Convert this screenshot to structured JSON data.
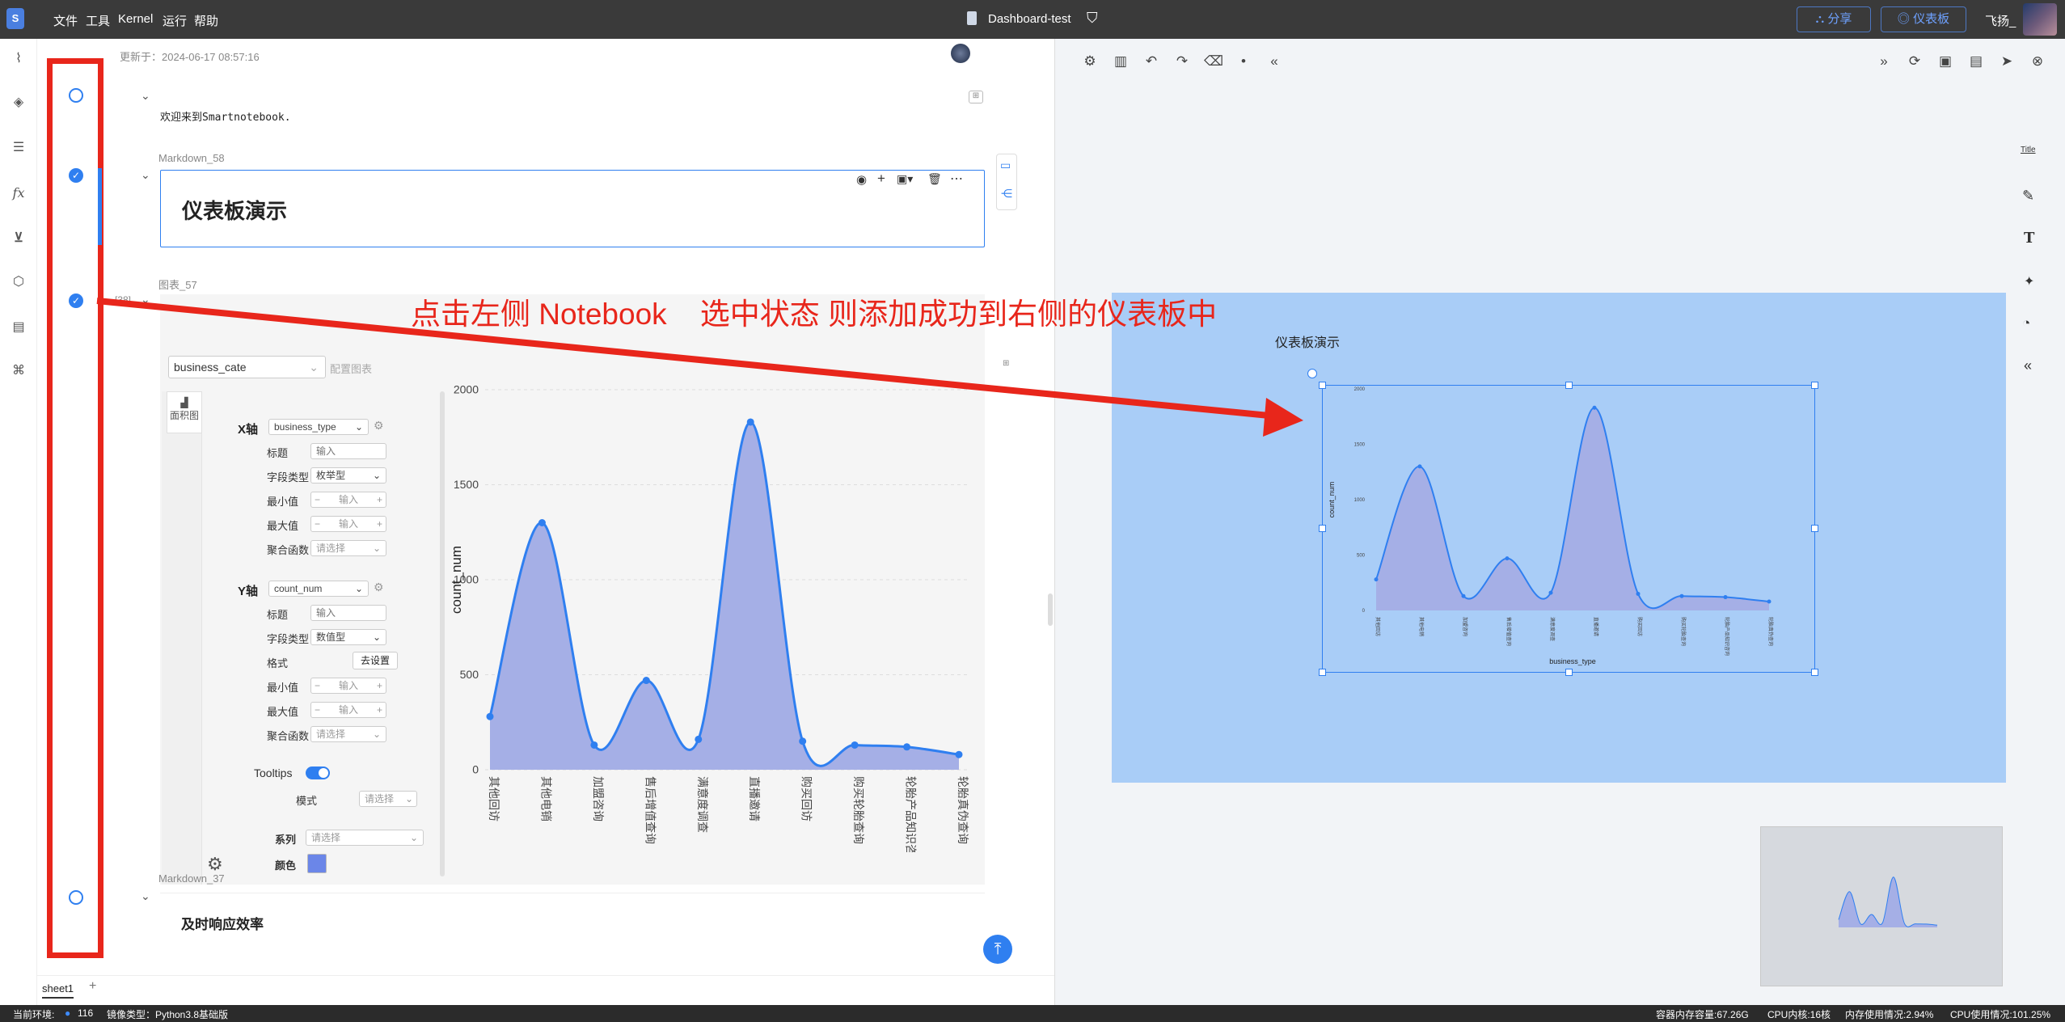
{
  "topbar": {
    "logo": "S",
    "menu": [
      "文件",
      "工具",
      "Kernel",
      "运行",
      "帮助"
    ],
    "title": "Dashboard-test",
    "share_label": "分享",
    "dashboard_label": "仪表板",
    "user": "飞扬_"
  },
  "notebook": {
    "updated": "更新于：2024-06-17 08:57:16",
    "welcome_text": "欢迎来到Smartnotebook.",
    "cell1_label": "Markdown_58",
    "cell1_heading": "仪表板演示",
    "cell2_label": "图表_57",
    "cell2_exec": "[38]",
    "cell3_label": "Markdown_37",
    "cell3_heading": "及时响应效率",
    "sheet_tab": "sheet1",
    "sheet_add": "+"
  },
  "chart_config": {
    "dataset_select": "business_cate",
    "dataset_extra": "配置图表",
    "chart_type_label": "面积图",
    "x_axis": {
      "label": "X轴",
      "field": "business_type",
      "title_label": "标题",
      "title_placeholder": "输入",
      "type_label": "字段类型",
      "type_value": "枚举型",
      "min_label": "最小值",
      "max_label": "最大值",
      "stepper_placeholder": "输入",
      "agg_label": "聚合函数",
      "agg_placeholder": "请选择"
    },
    "y_axis": {
      "label": "Y轴",
      "field": "count_num",
      "title_label": "标题",
      "title_placeholder": "输入",
      "type_label": "字段类型",
      "type_value": "数值型",
      "format_label": "格式",
      "format_button": "去设置",
      "min_label": "最小值",
      "max_label": "最大值",
      "stepper_placeholder": "输入",
      "agg_label": "聚合函数",
      "agg_placeholder": "请选择"
    },
    "tooltips_label": "Tooltips",
    "mode_label": "模式",
    "mode_placeholder": "请选择",
    "series_label": "系列",
    "series_placeholder": "请选择",
    "color_label": "颜色"
  },
  "annotation": {
    "text": "点击左侧 Notebook    选中状态 则添加成功到右侧的仪表板中",
    "color": "#e8261b"
  },
  "dashboard": {
    "heading": "仪表板演示",
    "right_tools": [
      "Title",
      "pencil-square",
      "T",
      "sparkle",
      "palette",
      "chevron-double-left"
    ],
    "bg_color": "#a9cdf7"
  },
  "status": {
    "env_label": "当前环境:",
    "env_value": "116",
    "image_label": "镜像类型：Python3.8基础版",
    "mem": "容器内存容量:67.26G",
    "cpu_cores": "CPU内核:16核",
    "mem_used": "内存使用情况:2.94%",
    "cpu_used": "CPU使用情况:101.25%"
  },
  "colors": {
    "accent": "#2f7ff0",
    "area_fill": "#a5afe6",
    "line": "#2f7ff0",
    "topbar": "#3a3a3a"
  },
  "chart_data": {
    "type": "area",
    "categories": [
      "其他回访",
      "其他电销",
      "加盟咨询",
      "售后增值查询",
      "满意度调查",
      "直播邀请",
      "购买回访",
      "购买轮胎查询",
      "轮胎产品知识咨询",
      "轮胎真伪查询"
    ],
    "values": [
      280,
      1300,
      130,
      470,
      160,
      1830,
      150,
      130,
      120,
      80
    ],
    "xlabel": "business_type",
    "ylabel": "count_num",
    "ylim": [
      0,
      2000
    ],
    "yticks": [
      0,
      500,
      1000,
      1500,
      2000
    ],
    "grid": true
  }
}
